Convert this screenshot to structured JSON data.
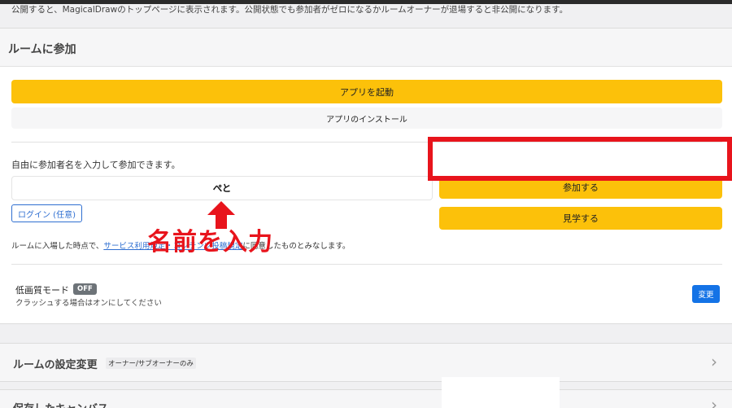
{
  "top_note": "公開すると、MagicalDrawのトップページに表示されます。公開状態でも参加者がゼロになるかルームオーナーが退場すると非公開になります。",
  "join_panel": {
    "title": "ルームに参加",
    "launch_button": "アプリを起動",
    "install_button": "アプリのインストール",
    "description": "自由に参加者名を入力して参加できます。",
    "name_input_value": "ぺと",
    "join_button": "参加する",
    "watch_button": "見学する",
    "login_button": "ログイン (任意)",
    "terms_prefix": "ルームに入場した時点で、",
    "terms_link1": "サービス利用規定・コンテンツ投稿規定",
    "terms_suffix": "に同意したものとみなします。",
    "low_quality_label": "低画質モード",
    "low_quality_state": "OFF",
    "low_quality_sub": "クラッシュする場合はオンにしてください",
    "change_button": "変更"
  },
  "annotation": {
    "text": "名前を入力",
    "color": "#e8141c"
  },
  "settings_panel": {
    "title": "ルームの設定変更",
    "badge": "オーナー/サブオーナーのみ"
  },
  "canvas_panel": {
    "title": "保存したキャンバス"
  },
  "colors": {
    "accent_yellow": "#fcc10a",
    "link_blue": "#2f6fd1",
    "primary_blue": "#1473e6",
    "highlight_red": "#e8141c"
  }
}
